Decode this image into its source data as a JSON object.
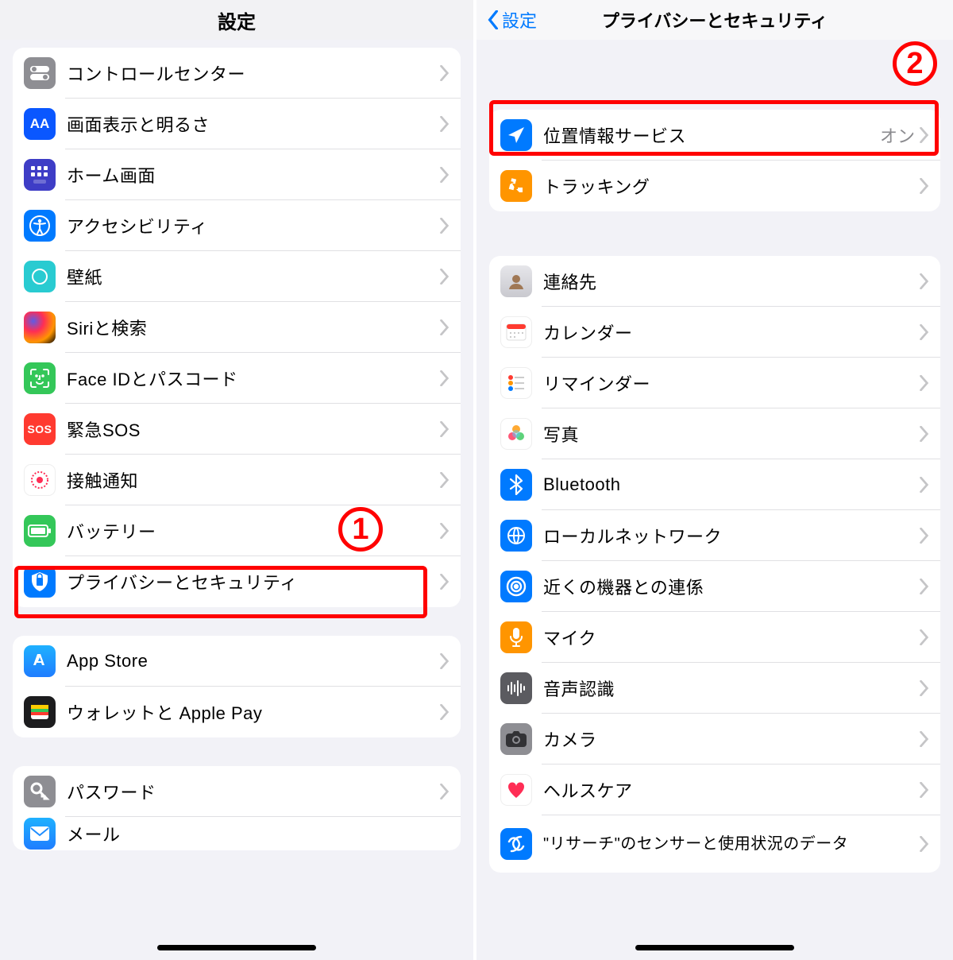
{
  "colors": {
    "sysGray": "#8e8e93",
    "sysGray5": "#d1d1d6",
    "blue": "#007aff",
    "green": "#34c759",
    "red": "#ff2d55",
    "orange": "#ff9500",
    "teal": "#5ac8fa",
    "darkGray": "#4a4a4a"
  },
  "left": {
    "title": "設定",
    "annotationNumber": "1",
    "groups": [
      {
        "rows": [
          {
            "id": "control-center",
            "label": "コントロールセンター",
            "iconBg": "#8e8e93"
          },
          {
            "id": "display",
            "label": "画面表示と明るさ",
            "iconBg": "#0a57ff",
            "glyph": "AA"
          },
          {
            "id": "home-screen",
            "label": "ホーム画面",
            "iconBg": "#3e3dc6"
          },
          {
            "id": "accessibility",
            "label": "アクセシビリティ",
            "iconBg": "#007aff"
          },
          {
            "id": "wallpaper",
            "label": "壁紙",
            "iconBg": "#29cbd1"
          },
          {
            "id": "siri",
            "label": "Siriと検索",
            "iconBg": "#1c1c1e"
          },
          {
            "id": "faceid",
            "label": "Face IDとパスコード",
            "iconBg": "#34c759"
          },
          {
            "id": "sos",
            "label": "緊急SOS",
            "iconBg": "#ff3a30",
            "glyph": "SOS"
          },
          {
            "id": "exposure",
            "label": "接触通知",
            "iconBg": "#ffffff"
          },
          {
            "id": "battery",
            "label": "バッテリー",
            "iconBg": "#34c759"
          },
          {
            "id": "privacy",
            "label": "プライバシーとセキュリティ",
            "iconBg": "#007aff",
            "highlighted": true
          }
        ]
      },
      {
        "rows": [
          {
            "id": "appstore",
            "label": "App Store",
            "iconBg": "#1f98ff"
          },
          {
            "id": "wallet",
            "label": "ウォレットと Apple Pay",
            "iconBg": "#1c1c1e"
          }
        ]
      },
      {
        "rows": [
          {
            "id": "passwords",
            "label": "パスワード",
            "iconBg": "#8e8e93"
          },
          {
            "id": "mail",
            "label": "メール",
            "iconBg": "#1f98ff"
          }
        ]
      }
    ]
  },
  "right": {
    "backLabel": "設定",
    "title": "プライバシーとセキュリティ",
    "annotationNumber": "2",
    "groups": [
      {
        "highlightFirst": true,
        "rows": [
          {
            "id": "location",
            "label": "位置情報サービス",
            "value": "オン",
            "iconBg": "#007aff"
          },
          {
            "id": "tracking",
            "label": "トラッキング",
            "iconBg": "#ff9500"
          }
        ]
      },
      {
        "rows": [
          {
            "id": "contacts",
            "label": "連絡先",
            "iconBg": "#d9d9de"
          },
          {
            "id": "calendar",
            "label": "カレンダー",
            "iconBg": "#ffffff"
          },
          {
            "id": "reminders",
            "label": "リマインダー",
            "iconBg": "#ffffff"
          },
          {
            "id": "photos",
            "label": "写真",
            "iconBg": "#ffffff"
          },
          {
            "id": "bluetooth",
            "label": "Bluetooth",
            "iconBg": "#007aff"
          },
          {
            "id": "localnet",
            "label": "ローカルネットワーク",
            "iconBg": "#007aff"
          },
          {
            "id": "nearby",
            "label": "近くの機器との連係",
            "iconBg": "#007aff"
          },
          {
            "id": "microphone",
            "label": "マイク",
            "iconBg": "#ff9500"
          },
          {
            "id": "speech",
            "label": "音声認識",
            "iconBg": "#5b5b60"
          },
          {
            "id": "camera",
            "label": "カメラ",
            "iconBg": "#8e8e93"
          },
          {
            "id": "health",
            "label": "ヘルスケア",
            "iconBg": "#ffffff"
          },
          {
            "id": "research",
            "label": "\"リサーチ\"のセンサーと使用状況のデータ",
            "iconBg": "#007aff",
            "twoLine": true
          }
        ]
      }
    ]
  }
}
